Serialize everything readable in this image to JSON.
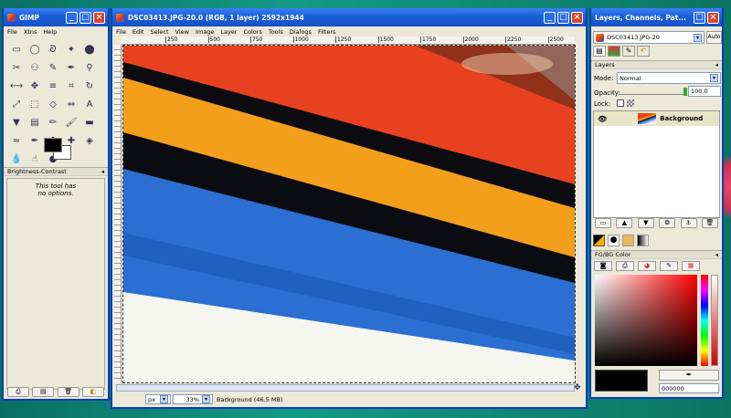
{
  "toolbox": {
    "title": "GIMP",
    "menus": [
      "File",
      "Xtns",
      "Help"
    ],
    "tools": [
      "rect-select",
      "ellipse-select",
      "free-select",
      "fuzzy-select",
      "select-by-color",
      "scissors",
      "foreground-select",
      "paths",
      "color-picker",
      "zoom",
      "measure",
      "move",
      "align",
      "crop",
      "rotate",
      "scale",
      "shear",
      "perspective",
      "flip",
      "text",
      "bucket-fill",
      "blend",
      "pencil",
      "paintbrush",
      "eraser",
      "airbrush",
      "ink",
      "clone",
      "heal",
      "perspective-clone",
      "blur",
      "smudge",
      "dodge"
    ],
    "tool_glyphs": [
      "▭",
      "◯",
      "ᘐ",
      "✦",
      "⬤",
      "✂",
      "⚇",
      "✎",
      "✒",
      "⚲",
      "⟷",
      "✥",
      "≡",
      "⌗",
      "↻",
      "⤢",
      "⬚",
      "◇",
      "⇔",
      "A",
      "▼",
      "▤",
      "✏",
      "🖌",
      "▬",
      "≈",
      "✒",
      "♣",
      "✚",
      "◈",
      "💧",
      "☝",
      "●"
    ],
    "options_title": "Brightness-Contrast",
    "options_text": [
      "This tool has",
      "no options."
    ],
    "bottom_buttons": [
      "save",
      "restore",
      "delete",
      "reset"
    ]
  },
  "image_window": {
    "title": "DSC03413.JPG-20.0 (RGB, 1 layer) 2592x1944",
    "menus": [
      "File",
      "Edit",
      "Select",
      "View",
      "Image",
      "Layer",
      "Colors",
      "Tools",
      "Dialogs",
      "Filters"
    ],
    "ruler_marks": [
      "250",
      "500",
      "750",
      "1000",
      "1250",
      "1500",
      "1750",
      "2000",
      "2250",
      "2500"
    ],
    "unit": "px",
    "zoom": "33%",
    "status": "Background (46.5 MB)"
  },
  "dock": {
    "title": "Layers, Channels, Pat...",
    "image_select": "DSC03413.JPG-20",
    "auto_label": "Auto",
    "layers": {
      "header": "Layers",
      "mode_label": "Mode:",
      "mode_value": "Normal",
      "opacity_label": "Opacity:",
      "opacity_value": "100.0",
      "lock_label": "Lock:",
      "layer_name": "Background"
    },
    "fgbg": {
      "header": "FG/BG Color",
      "hex_value": "000000"
    }
  },
  "colors": {
    "titlebar": "#1a5fd8",
    "fg": "#000000",
    "bg": "#ffffff"
  }
}
